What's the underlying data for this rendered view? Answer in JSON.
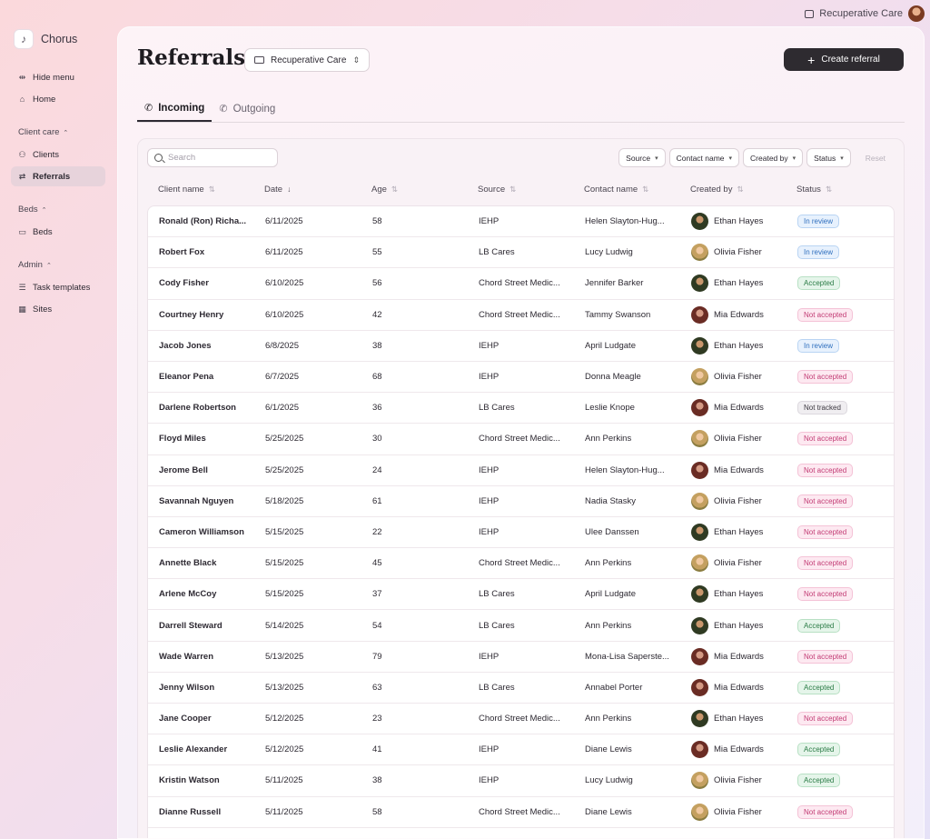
{
  "topbar": {
    "org_name": "Recuperative Care"
  },
  "sidebar": {
    "brand": "Chorus",
    "hide_menu": "Hide menu",
    "home": "Home",
    "sections": [
      {
        "title": "Client care",
        "items": [
          "Clients",
          "Referrals"
        ]
      },
      {
        "title": "Beds",
        "items": [
          "Beds"
        ]
      },
      {
        "title": "Admin",
        "items": [
          "Task templates",
          "Sites"
        ]
      }
    ],
    "active_item": "Referrals"
  },
  "header": {
    "title": "Referrals",
    "org_select": "Recuperative Care",
    "create_button": "Create referral"
  },
  "tabs": [
    {
      "label": "Incoming",
      "active": true
    },
    {
      "label": "Outgoing",
      "active": false
    }
  ],
  "search": {
    "placeholder": "Search",
    "value": ""
  },
  "filters": [
    "Source",
    "Contact name",
    "Created by",
    "Status"
  ],
  "reset_label": "Reset",
  "table": {
    "columns": [
      "Client name",
      "Date",
      "Age",
      "Source",
      "Contact name",
      "Created by",
      "Status"
    ],
    "sorted_column": "Date",
    "rows": [
      {
        "name": "Ronald (Ron) Richa...",
        "date": "6/11/2025",
        "age": "58",
        "source": "IEHP",
        "contact": "Helen Slayton-Hug...",
        "creator": "Ethan Hayes",
        "status": "In review"
      },
      {
        "name": "Robert Fox",
        "date": "6/11/2025",
        "age": "55",
        "source": "LB Cares",
        "contact": "Lucy Ludwig",
        "creator": "Olivia Fisher",
        "status": "In review"
      },
      {
        "name": "Cody Fisher",
        "date": "6/10/2025",
        "age": "56",
        "source": "Chord Street Medic...",
        "contact": "Jennifer Barker",
        "creator": "Ethan Hayes",
        "status": "Accepted"
      },
      {
        "name": "Courtney Henry",
        "date": "6/10/2025",
        "age": "42",
        "source": "Chord Street Medic...",
        "contact": "Tammy Swanson",
        "creator": "Mia Edwards",
        "status": "Not accepted"
      },
      {
        "name": "Jacob Jones",
        "date": "6/8/2025",
        "age": "38",
        "source": "IEHP",
        "contact": "April Ludgate",
        "creator": "Ethan Hayes",
        "status": "In review"
      },
      {
        "name": "Eleanor Pena",
        "date": "6/7/2025",
        "age": "68",
        "source": "IEHP",
        "contact": "Donna Meagle",
        "creator": "Olivia Fisher",
        "status": "Not accepted"
      },
      {
        "name": "Darlene Robertson",
        "date": "6/1/2025",
        "age": "36",
        "source": "LB Cares",
        "contact": "Leslie Knope",
        "creator": "Mia Edwards",
        "status": "Not tracked"
      },
      {
        "name": "Floyd Miles",
        "date": "5/25/2025",
        "age": "30",
        "source": "Chord Street Medic...",
        "contact": "Ann Perkins",
        "creator": "Olivia Fisher",
        "status": "Not accepted"
      },
      {
        "name": "Jerome Bell",
        "date": "5/25/2025",
        "age": "24",
        "source": "IEHP",
        "contact": "Helen Slayton-Hug...",
        "creator": "Mia Edwards",
        "status": "Not accepted"
      },
      {
        "name": "Savannah Nguyen",
        "date": "5/18/2025",
        "age": "61",
        "source": "IEHP",
        "contact": "Nadia Stasky",
        "creator": "Olivia Fisher",
        "status": "Not accepted"
      },
      {
        "name": "Cameron Williamson",
        "date": "5/15/2025",
        "age": "22",
        "source": "IEHP",
        "contact": "Ulee Danssen",
        "creator": "Ethan Hayes",
        "status": "Not accepted"
      },
      {
        "name": "Annette Black",
        "date": "5/15/2025",
        "age": "45",
        "source": "Chord Street Medic...",
        "contact": "Ann Perkins",
        "creator": "Olivia Fisher",
        "status": "Not accepted"
      },
      {
        "name": "Arlene McCoy",
        "date": "5/15/2025",
        "age": "37",
        "source": "LB Cares",
        "contact": "April Ludgate",
        "creator": "Ethan Hayes",
        "status": "Not accepted"
      },
      {
        "name": "Darrell Steward",
        "date": "5/14/2025",
        "age": "54",
        "source": "LB Cares",
        "contact": "Ann Perkins",
        "creator": "Ethan Hayes",
        "status": "Accepted"
      },
      {
        "name": "Wade Warren",
        "date": "5/13/2025",
        "age": "79",
        "source": "IEHP",
        "contact": "Mona-Lisa Saperste...",
        "creator": "Mia Edwards",
        "status": "Not accepted"
      },
      {
        "name": "Jenny Wilson",
        "date": "5/13/2025",
        "age": "63",
        "source": "LB Cares",
        "contact": "Annabel Porter",
        "creator": "Mia Edwards",
        "status": "Accepted"
      },
      {
        "name": "Jane Cooper",
        "date": "5/12/2025",
        "age": "23",
        "source": "Chord Street Medic...",
        "contact": "Ann Perkins",
        "creator": "Ethan Hayes",
        "status": "Not accepted"
      },
      {
        "name": "Leslie Alexander",
        "date": "5/12/2025",
        "age": "41",
        "source": "IEHP",
        "contact": "Diane Lewis",
        "creator": "Mia Edwards",
        "status": "Accepted"
      },
      {
        "name": "Kristin Watson",
        "date": "5/11/2025",
        "age": "38",
        "source": "IEHP",
        "contact": "Lucy Ludwig",
        "creator": "Olivia Fisher",
        "status": "Accepted"
      },
      {
        "name": "Dianne Russell",
        "date": "5/11/2025",
        "age": "58",
        "source": "Chord Street Medic...",
        "contact": "Diane Lewis",
        "creator": "Olivia Fisher",
        "status": "Not accepted"
      }
    ]
  },
  "colors": {
    "in_review": "#2f6fbe",
    "accepted": "#2a7b45",
    "not_accepted": "#c23b74",
    "not_tracked": "#3c3840",
    "primary_button": "#2e2b30"
  }
}
